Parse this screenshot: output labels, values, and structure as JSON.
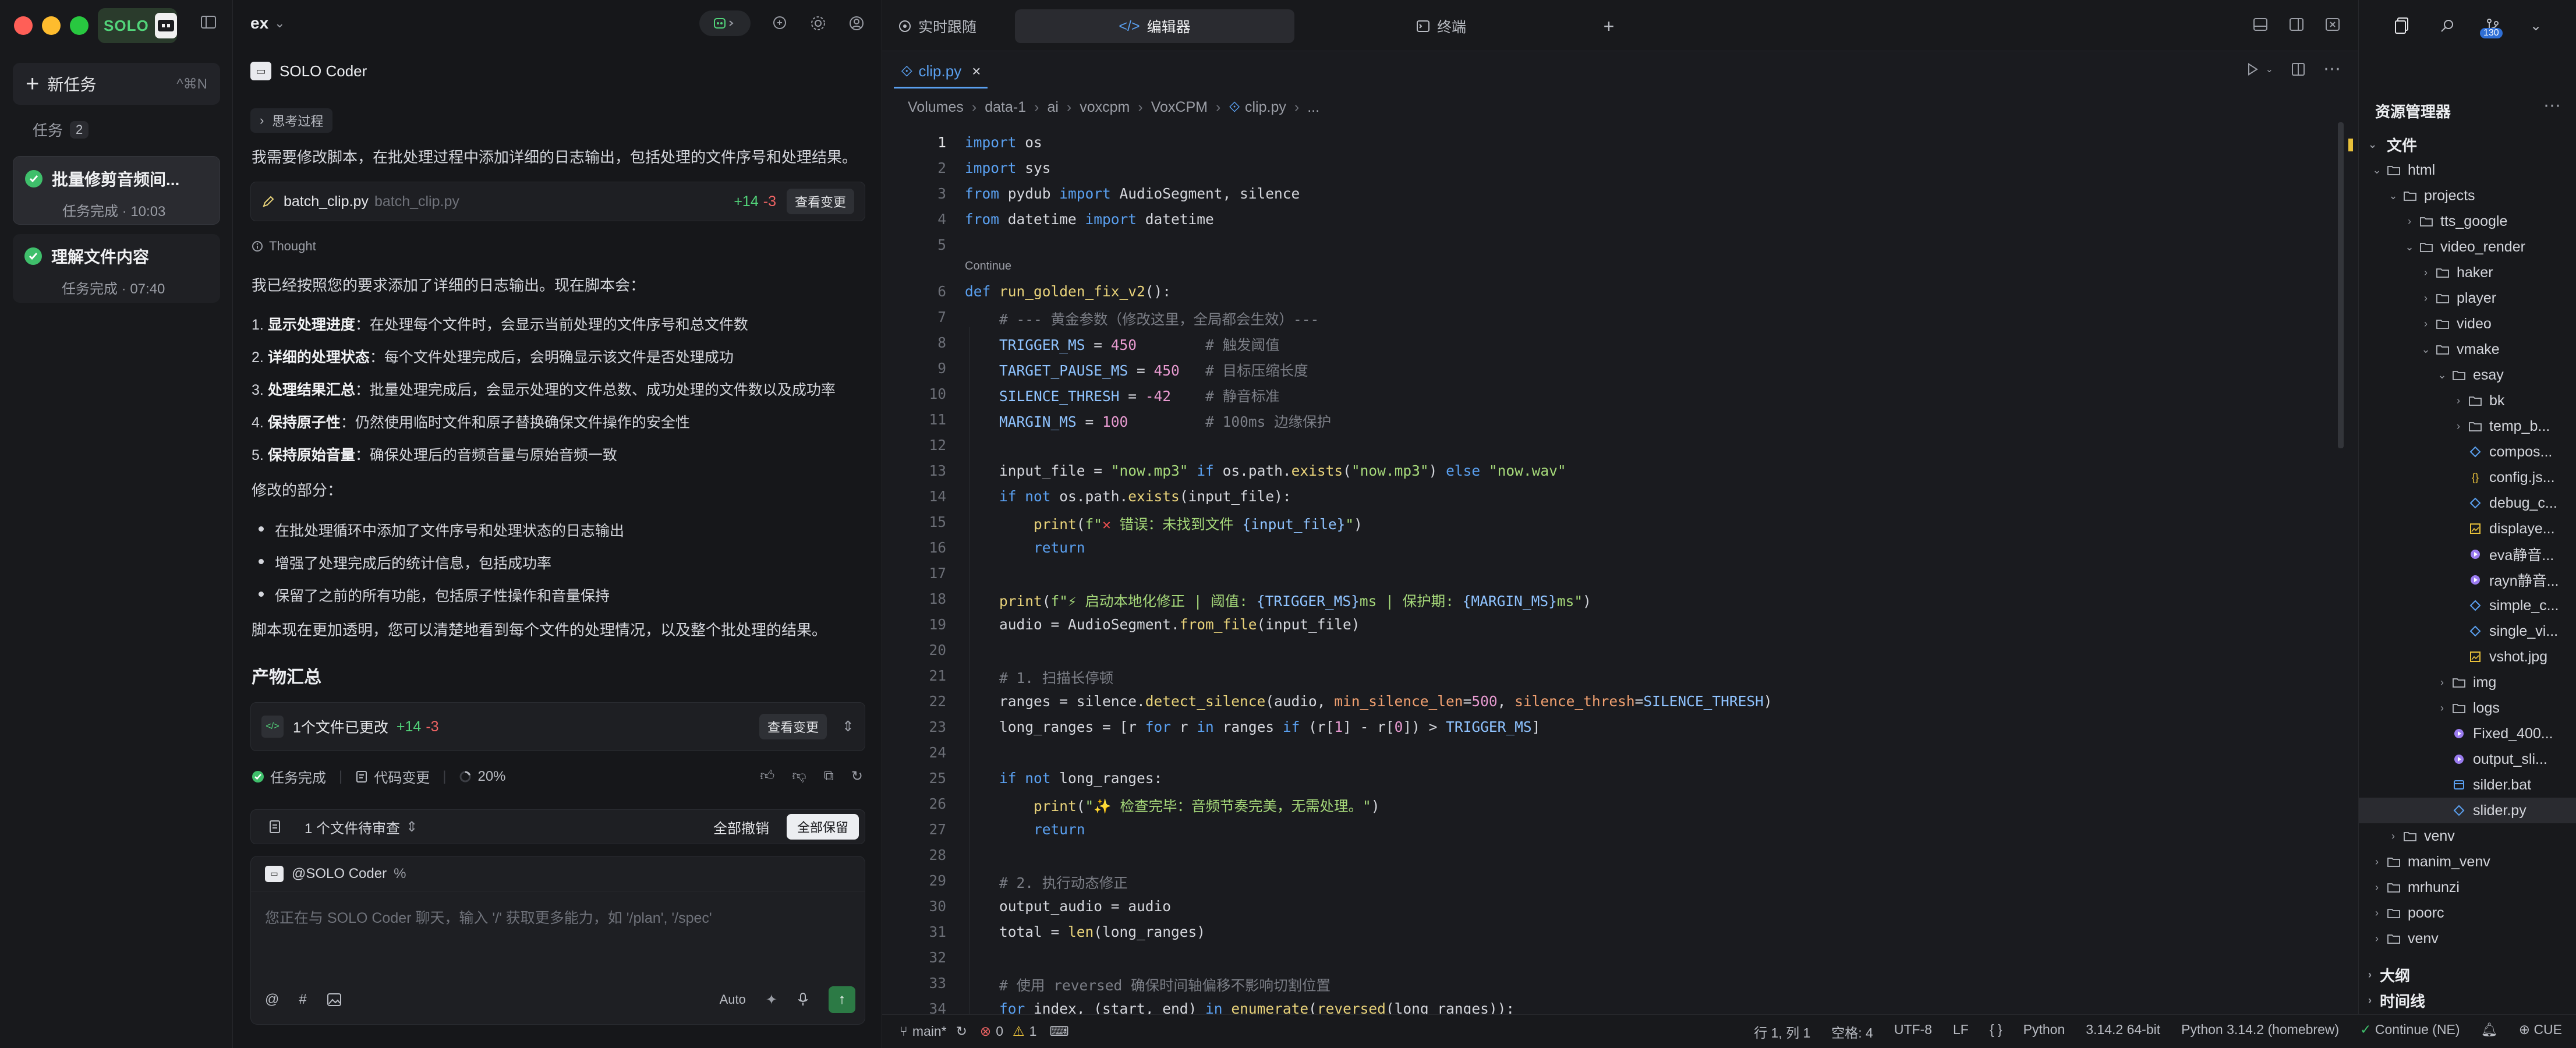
{
  "sidebar": {
    "brand": "SOLO",
    "new_task": {
      "label": "新任务",
      "shortcut": "^⌘N"
    },
    "tasks_header": "任务",
    "tasks_count": "2",
    "tasks": [
      {
        "title": "批量修剪音频间...",
        "status": "任务完成 · 10:03"
      },
      {
        "title": "理解文件内容",
        "status": "任务完成 · 07:40"
      }
    ]
  },
  "chat": {
    "project": "ex",
    "agent_name": "SOLO Coder",
    "think_label": "思考过程",
    "intro": "我需要修改脚本，在批处理过程中添加详细的日志输出，包括处理的文件序号和处理结果。",
    "file_card": {
      "name": "batch_clip.py",
      "path": "batch_clip.py",
      "plus": "+14",
      "minus": "-3",
      "button": "查看变更"
    },
    "thought_label": "Thought",
    "summary_intro": "我已经按照您的要求添加了详细的日志输出。现在脚本会：",
    "numbered": [
      {
        "n": "1.",
        "title": "显示处理进度",
        "text": "：在处理每个文件时，会显示当前处理的文件序号和总文件数"
      },
      {
        "n": "2.",
        "title": "详细的处理状态",
        "text": "：每个文件处理完成后，会明确显示该文件是否处理成功"
      },
      {
        "n": "3.",
        "title": "处理结果汇总",
        "text": "：批量处理完成后，会显示处理的文件总数、成功处理的文件数以及成功率"
      },
      {
        "n": "4.",
        "title": "保持原子性",
        "text": "：仍然使用临时文件和原子替换确保文件操作的安全性"
      },
      {
        "n": "5.",
        "title": "保持原始音量",
        "text": "：确保处理后的音频音量与原始音频一致"
      }
    ],
    "modified_header": "修改的部分：",
    "bullets": [
      "在批处理循环中添加了文件序号和处理状态的日志输出",
      "增强了处理完成后的统计信息，包括成功率",
      "保留了之前的所有功能，包括原子性操作和音量保持"
    ],
    "conclusion": "脚本现在更加透明，您可以清楚地看到每个文件的处理情况，以及整个批处理的结果。",
    "artifacts_title": "产物汇总",
    "changes": {
      "label": "1个文件已更改",
      "plus": "+14",
      "minus": "-3",
      "button": "查看变更"
    },
    "status_row": {
      "done": "任务完成",
      "code_changes": "代码变更",
      "progress": "20%"
    },
    "review": {
      "label": "1 个文件待审查",
      "discard": "全部撤销",
      "keep": "全部保留"
    },
    "composer": {
      "mention": "@SOLO Coder",
      "placeholder": "您正在与 SOLO Coder 聊天，输入 '/' 获取更多能力，如 '/plan', '/spec'",
      "mode": "Auto"
    }
  },
  "editor": {
    "top_tabs": [
      "实时跟随",
      "编辑器",
      "终端"
    ],
    "file_tab": "clip.py",
    "breadcrumbs": [
      "Volumes",
      "data-1",
      "ai",
      "voxcpm",
      "VoxCPM",
      "clip.py",
      "..."
    ],
    "continue_label": "Continue",
    "lines": [
      {
        "n": "1",
        "html": "<span class='kw'>import</span> os"
      },
      {
        "n": "2",
        "html": "<span class='kw'>import</span> sys"
      },
      {
        "n": "3",
        "html": "<span class='kw'>from</span> pydub <span class='kw'>import</span> AudioSegment, silence"
      },
      {
        "n": "4",
        "html": "<span class='kw'>from</span> datetime <span class='kw'>import</span> datetime"
      },
      {
        "n": "5",
        "html": ""
      },
      {
        "n": "6",
        "html": "<span class='kw'>def</span> <span class='fn'>run_golden_fix_v2</span>():"
      },
      {
        "n": "7",
        "html": "    <span class='cm'># --- 黄金参数（修改这里，全局都会生效）---</span>"
      },
      {
        "n": "8",
        "html": "    <span class='var'>TRIGGER_MS</span> = <span class='num'>450</span>        <span class='cm'># 触发阈值</span>"
      },
      {
        "n": "9",
        "html": "    <span class='var'>TARGET_PAUSE_MS</span> = <span class='num'>450</span>   <span class='cm'># 目标压缩长度</span>"
      },
      {
        "n": "10",
        "html": "    <span class='var'>SILENCE_THRESH</span> = <span class='num'>-42</span>    <span class='cm'># 静音标准</span>"
      },
      {
        "n": "11",
        "html": "    <span class='var'>MARGIN_MS</span> = <span class='num'>100</span>         <span class='cm'># 100ms 边缘保护</span>"
      },
      {
        "n": "12",
        "html": ""
      },
      {
        "n": "13",
        "html": "    input_file = <span class='str'>\"now.mp3\"</span> <span class='kw'>if</span> os.path.<span class='fn'>exists</span>(<span class='str'>\"now.mp3\"</span>) <span class='kw'>else</span> <span class='str'>\"now.wav\"</span>"
      },
      {
        "n": "14",
        "html": "    <span class='kw'>if not</span> os.path.<span class='fn'>exists</span>(input_file):"
      },
      {
        "n": "15",
        "html": "        <span class='fn'>print</span>(<span class='str'>f\"</span><span style='color:#f05050'>✕</span><span class='str'> 错误：未找到文件 </span><span class='var'>{input_file}</span><span class='str'>\"</span>)"
      },
      {
        "n": "16",
        "html": "        <span class='kw'>return</span>"
      },
      {
        "n": "17",
        "html": ""
      },
      {
        "n": "18",
        "html": "    <span class='fn'>print</span>(<span class='str'>f\"⚡ 启动本地化修正 | 阈值: </span><span class='var'>{TRIGGER_MS}</span><span class='str'>ms | 保护期: </span><span class='var'>{MARGIN_MS}</span><span class='str'>ms\"</span>)"
      },
      {
        "n": "19",
        "html": "    audio = AudioSegment.<span class='fn'>from_file</span>(input_file)"
      },
      {
        "n": "20",
        "html": ""
      },
      {
        "n": "21",
        "html": "    <span class='cm'># 1. 扫描长停顿</span>"
      },
      {
        "n": "22",
        "html": "    ranges = silence.<span class='fn'>detect_silence</span>(audio, <span class='param'>min_silence_len</span>=<span class='num'>500</span>, <span class='param'>silence_thresh</span>=<span class='var'>SILENCE_THRESH</span>)"
      },
      {
        "n": "23",
        "html": "    long_ranges = [r <span class='kw'>for</span> r <span class='kw'>in</span> ranges <span class='kw'>if</span> (r[<span class='num'>1</span>] - r[<span class='num'>0</span>]) > <span class='var'>TRIGGER_MS</span>]"
      },
      {
        "n": "24",
        "html": ""
      },
      {
        "n": "25",
        "html": "    <span class='kw'>if not</span> long_ranges:"
      },
      {
        "n": "26",
        "html": "        <span class='fn'>print</span>(<span class='str'>\"✨ 检查完毕：音频节奏完美，无需处理。\"</span>)"
      },
      {
        "n": "27",
        "html": "        <span class='kw'>return</span>"
      },
      {
        "n": "28",
        "html": ""
      },
      {
        "n": "29",
        "html": "    <span class='cm'># 2. 执行动态修正</span>"
      },
      {
        "n": "30",
        "html": "    output_audio = audio"
      },
      {
        "n": "31",
        "html": "    total = <span class='fn'>len</span>(long_ranges)"
      },
      {
        "n": "32",
        "html": ""
      },
      {
        "n": "33",
        "html": "    <span class='cm'># 使用 reversed 确保时间轴偏移不影响切割位置</span>"
      },
      {
        "n": "34",
        "html": "    <span class='kw'>for</span> index, (start, end) <span class='kw'>in</span> <span class='fn'>enumerate</span>(<span class='fn'>reversed</span>(long_ranges)):"
      }
    ]
  },
  "explorer": {
    "title": "资源管理器",
    "badge": "130",
    "section_files": "文件",
    "tree": [
      {
        "name": "html",
        "depth": 0,
        "type": "folder-open"
      },
      {
        "name": "projects",
        "depth": 1,
        "type": "folder-open"
      },
      {
        "name": "tts_google",
        "depth": 2,
        "type": "folder"
      },
      {
        "name": "video_render",
        "depth": 2,
        "type": "folder-open"
      },
      {
        "name": "haker",
        "depth": 3,
        "type": "folder"
      },
      {
        "name": "player",
        "depth": 3,
        "type": "folder"
      },
      {
        "name": "video",
        "depth": 3,
        "type": "folder"
      },
      {
        "name": "vmake",
        "depth": 3,
        "type": "folder-open"
      },
      {
        "name": "esay",
        "depth": 4,
        "type": "folder-open"
      },
      {
        "name": "bk",
        "depth": 5,
        "type": "folder"
      },
      {
        "name": "temp_b...",
        "depth": 5,
        "type": "folder"
      },
      {
        "name": "compos...",
        "depth": 5,
        "type": "file-docker"
      },
      {
        "name": "config.js...",
        "depth": 5,
        "type": "file-json"
      },
      {
        "name": "debug_c...",
        "depth": 5,
        "type": "file-py"
      },
      {
        "name": "displaye...",
        "depth": 5,
        "type": "file-img"
      },
      {
        "name": "eva静音...",
        "depth": 5,
        "type": "file-audio"
      },
      {
        "name": "rayn静音...",
        "depth": 5,
        "type": "file-audio"
      },
      {
        "name": "simple_c...",
        "depth": 5,
        "type": "file-py"
      },
      {
        "name": "single_vi...",
        "depth": 5,
        "type": "file-py"
      },
      {
        "name": "vshot.jpg",
        "depth": 5,
        "type": "file-img"
      },
      {
        "name": "img",
        "depth": 4,
        "type": "folder"
      },
      {
        "name": "logs",
        "depth": 4,
        "type": "folder"
      },
      {
        "name": "Fixed_400...",
        "depth": 4,
        "type": "file-audio"
      },
      {
        "name": "output_sli...",
        "depth": 4,
        "type": "file-audio"
      },
      {
        "name": "silder.bat",
        "depth": 4,
        "type": "file-bat"
      },
      {
        "name": "slider.py",
        "depth": 4,
        "type": "file-py",
        "selected": true
      },
      {
        "name": "venv",
        "depth": 1,
        "type": "folder"
      },
      {
        "name": "manim_venv",
        "depth": 0,
        "type": "folder"
      },
      {
        "name": "mrhunzi",
        "depth": 0,
        "type": "folder"
      },
      {
        "name": "poorc",
        "depth": 0,
        "type": "folder"
      },
      {
        "name": "venv",
        "depth": 0,
        "type": "folder"
      }
    ],
    "section_outline": "大纲",
    "section_timeline": "时间线"
  },
  "statusbar": {
    "branch": "main*",
    "errors": "0",
    "warnings": "1",
    "position": "行 1, 列 1",
    "spaces": "空格: 4",
    "encoding": "UTF-8",
    "eol": "LF",
    "braces": "{ }",
    "language": "Python",
    "interpreter_version": "3.14.2 64-bit",
    "interpreter": "Python 3.14.2 (homebrew)",
    "continue": "Continue (NE)",
    "cue": "CUE"
  },
  "colors": {
    "accent_green": "#3fbf6b",
    "accent_blue": "#5aa0f0",
    "close": "#ff5f57",
    "minimize": "#febc2e",
    "maximize": "#28c840"
  }
}
